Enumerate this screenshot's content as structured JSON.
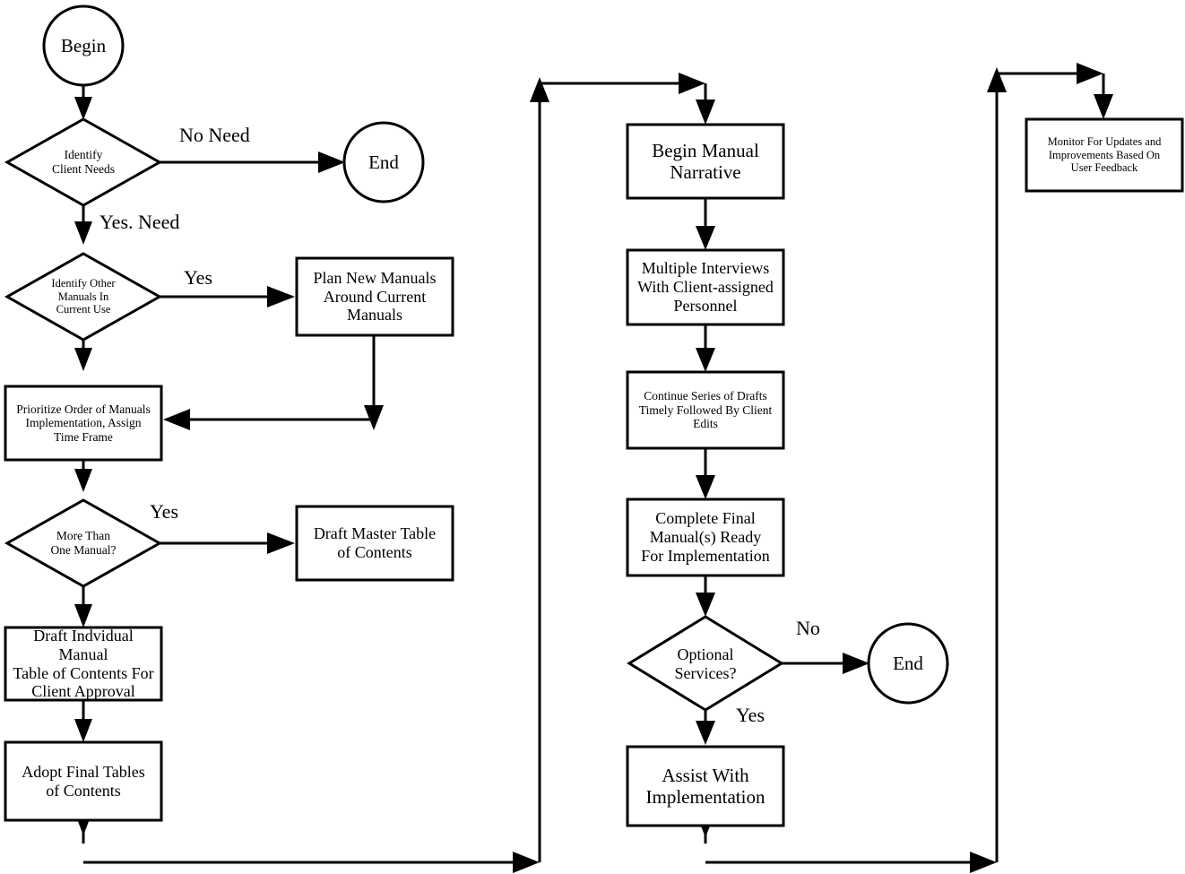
{
  "diagram": {
    "title": "Manual Development Process Flowchart",
    "background_color": "#ffffff",
    "line_color": "#000000",
    "node_fill": "#ffffff"
  },
  "nodes": {
    "begin": {
      "label": "Begin",
      "shape": "circle"
    },
    "identify_client_needs": {
      "label": "Identify\nClient Needs",
      "shape": "diamond"
    },
    "end_left": {
      "label": "End",
      "shape": "circle"
    },
    "identify_other_manuals": {
      "label": "Identify Other\nManuals In\nCurrent Use",
      "shape": "diamond"
    },
    "plan_new_manuals": {
      "label": "Plan New Manuals\nAround Current\nManuals",
      "shape": "rect"
    },
    "prioritize_order": {
      "label": "Prioritize Order of Manuals\nImplementation, Assign\nTime Frame",
      "shape": "rect"
    },
    "more_than_one_manual": {
      "label": "More Than\nOne Manual?",
      "shape": "diamond"
    },
    "draft_master_toc": {
      "label": "Draft Master Table\nof Contents",
      "shape": "rect"
    },
    "draft_individual_toc": {
      "label": "Draft Indvidual Manual\nTable of Contents For\nClient Approval",
      "shape": "rect"
    },
    "adopt_final_tables": {
      "label": "Adopt Final Tables\nof Contents",
      "shape": "rect"
    },
    "begin_manual_narrative": {
      "label": "Begin Manual\nNarrative",
      "shape": "rect"
    },
    "multiple_interviews": {
      "label": "Multiple Interviews\nWith Client-assigned\nPersonnel",
      "shape": "rect"
    },
    "continue_series_drafts": {
      "label": "Continue Series of Drafts\nTimely  Followed By Client\nEdits",
      "shape": "rect"
    },
    "complete_final_manuals": {
      "label": "Complete Final\nManual(s) Ready\nFor Implementation",
      "shape": "rect"
    },
    "optional_services": {
      "label": "Optional\nServices?",
      "shape": "diamond"
    },
    "end_middle": {
      "label": "End",
      "shape": "circle"
    },
    "assist_with_implementation": {
      "label": "Assist With\nImplementation",
      "shape": "rect"
    },
    "monitor_for_updates": {
      "label": "Monitor For Updates and\nImprovements Based On\nUser  Feedback",
      "shape": "rect"
    }
  },
  "edge_labels": {
    "no_need": "No Need",
    "yes_need": "Yes.  Need",
    "yes_other_manuals": "Yes",
    "yes_more_than_one": "Yes",
    "no_optional": "No",
    "yes_optional": "Yes"
  },
  "chart_data": {
    "type": "flowchart",
    "title": "Manual Development Process Flowchart",
    "columns": 3,
    "nodes": [
      {
        "id": "begin",
        "text": "Begin",
        "type": "terminator",
        "column": 1
      },
      {
        "id": "identify_client_needs",
        "text": "Identify Client Needs",
        "type": "decision",
        "column": 1
      },
      {
        "id": "end_left",
        "text": "End",
        "type": "terminator",
        "column": 1
      },
      {
        "id": "identify_other_manuals",
        "text": "Identify Other Manuals In Current Use",
        "type": "decision",
        "column": 1
      },
      {
        "id": "plan_new_manuals",
        "text": "Plan New Manuals Around Current Manuals",
        "type": "process",
        "column": 1
      },
      {
        "id": "prioritize_order",
        "text": "Prioritize Order of Manuals Implementation, Assign Time Frame",
        "type": "process",
        "column": 1
      },
      {
        "id": "more_than_one_manual",
        "text": "More Than One Manual?",
        "type": "decision",
        "column": 1
      },
      {
        "id": "draft_master_toc",
        "text": "Draft Master Table of Contents",
        "type": "process",
        "column": 1
      },
      {
        "id": "draft_individual_toc",
        "text": "Draft Indvidual Manual Table of Contents For Client Approval",
        "type": "process",
        "column": 1
      },
      {
        "id": "adopt_final_tables",
        "text": "Adopt Final Tables of Contents",
        "type": "process",
        "column": 1
      },
      {
        "id": "begin_manual_narrative",
        "text": "Begin Manual Narrative",
        "type": "process",
        "column": 2
      },
      {
        "id": "multiple_interviews",
        "text": "Multiple Interviews With Client-assigned Personnel",
        "type": "process",
        "column": 2
      },
      {
        "id": "continue_series_drafts",
        "text": "Continue Series of Drafts Timely Followed By Client Edits",
        "type": "process",
        "column": 2
      },
      {
        "id": "complete_final_manuals",
        "text": "Complete Final Manual(s) Ready For Implementation",
        "type": "process",
        "column": 2
      },
      {
        "id": "optional_services",
        "text": "Optional Services?",
        "type": "decision",
        "column": 2
      },
      {
        "id": "end_middle",
        "text": "End",
        "type": "terminator",
        "column": 2
      },
      {
        "id": "assist_with_implementation",
        "text": "Assist With Implementation",
        "type": "process",
        "column": 2
      },
      {
        "id": "monitor_for_updates",
        "text": "Monitor For Updates and Improvements Based On User Feedback",
        "type": "process",
        "column": 3
      }
    ],
    "edges": [
      {
        "from": "begin",
        "to": "identify_client_needs",
        "label": ""
      },
      {
        "from": "identify_client_needs",
        "to": "end_left",
        "label": "No Need"
      },
      {
        "from": "identify_client_needs",
        "to": "identify_other_manuals",
        "label": "Yes.  Need"
      },
      {
        "from": "identify_other_manuals",
        "to": "plan_new_manuals",
        "label": "Yes"
      },
      {
        "from": "identify_other_manuals",
        "to": "prioritize_order",
        "label": ""
      },
      {
        "from": "plan_new_manuals",
        "to": "prioritize_order",
        "label": ""
      },
      {
        "from": "prioritize_order",
        "to": "more_than_one_manual",
        "label": ""
      },
      {
        "from": "more_than_one_manual",
        "to": "draft_master_toc",
        "label": "Yes"
      },
      {
        "from": "more_than_one_manual",
        "to": "draft_individual_toc",
        "label": ""
      },
      {
        "from": "draft_individual_toc",
        "to": "adopt_final_tables",
        "label": ""
      },
      {
        "from": "adopt_final_tables",
        "to": "begin_manual_narrative",
        "label": ""
      },
      {
        "from": "begin_manual_narrative",
        "to": "multiple_interviews",
        "label": ""
      },
      {
        "from": "multiple_interviews",
        "to": "continue_series_drafts",
        "label": ""
      },
      {
        "from": "continue_series_drafts",
        "to": "complete_final_manuals",
        "label": ""
      },
      {
        "from": "complete_final_manuals",
        "to": "optional_services",
        "label": ""
      },
      {
        "from": "optional_services",
        "to": "end_middle",
        "label": "No"
      },
      {
        "from": "optional_services",
        "to": "assist_with_implementation",
        "label": "Yes"
      },
      {
        "from": "assist_with_implementation",
        "to": "monitor_for_updates",
        "label": ""
      }
    ]
  }
}
